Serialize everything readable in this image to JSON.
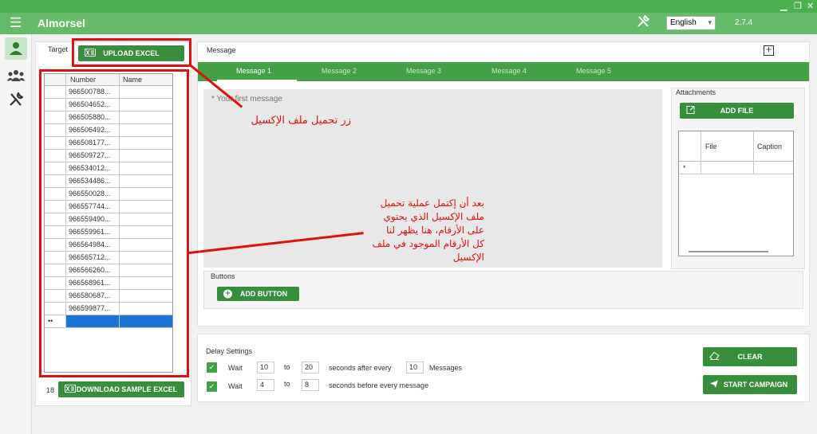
{
  "app": {
    "title": "Almorsel",
    "version": "2.7.4",
    "language": "English"
  },
  "target": {
    "label": "Target",
    "upload_label": "UPLOAD EXCEL",
    "download_label": "DOWNLOAD SAMPLE EXCEL",
    "count": "18",
    "columns": [
      "Number",
      "Name"
    ],
    "rows": [
      "966500788...",
      "966504652...",
      "966505880...",
      "966506492...",
      "966508177...",
      "966509727...",
      "966534012...",
      "966534486...",
      "966550028...",
      "966557744...",
      "966559490...",
      "966559961...",
      "966564984...",
      "966565712...",
      "966566260...",
      "966568961...",
      "966580687...",
      "966599877..."
    ],
    "new_row_marker": "••"
  },
  "message": {
    "label": "Message",
    "tabs": [
      "Message 1",
      "Message 2",
      "Message 3",
      "Message 4",
      "Message 5"
    ],
    "active_tab": "Message 1",
    "placeholder": "* Your first message"
  },
  "attachments": {
    "label": "Attachments",
    "add_file_label": "ADD FILE",
    "columns": [
      "File",
      "Caption"
    ],
    "new_row_marker": "*"
  },
  "buttons_section": {
    "label": "Buttons",
    "add_button_label": "ADD BUTTON"
  },
  "delay": {
    "label": "Delay Settings",
    "row1": {
      "wait": "Wait",
      "from": "10",
      "to_word": "to",
      "to": "20",
      "after": "seconds after every",
      "count": "10",
      "unit": "Messages"
    },
    "row2": {
      "wait": "Wait",
      "from": "4",
      "to_word": "to",
      "to": "8",
      "after": "seconds before every message"
    }
  },
  "actions": {
    "clear_label": "CLEAR",
    "start_label": "START CAMPAIGN"
  },
  "annotations": {
    "upload_note": "زر تحميل ملف الإكسيل",
    "grid_note": [
      "بعد أن إكتمل عملية تحميل",
      "ملف الإكسيل الذي يحتوي",
      "على الأرقام، هنا يظهر لنا",
      "كل الأرقام الموجود في ملف",
      "الإكسيل"
    ]
  },
  "colors": {
    "primary": "#43a047",
    "titlebar": "#66bb6a",
    "annotation": "#e01010",
    "selection": "#1a73d0"
  }
}
